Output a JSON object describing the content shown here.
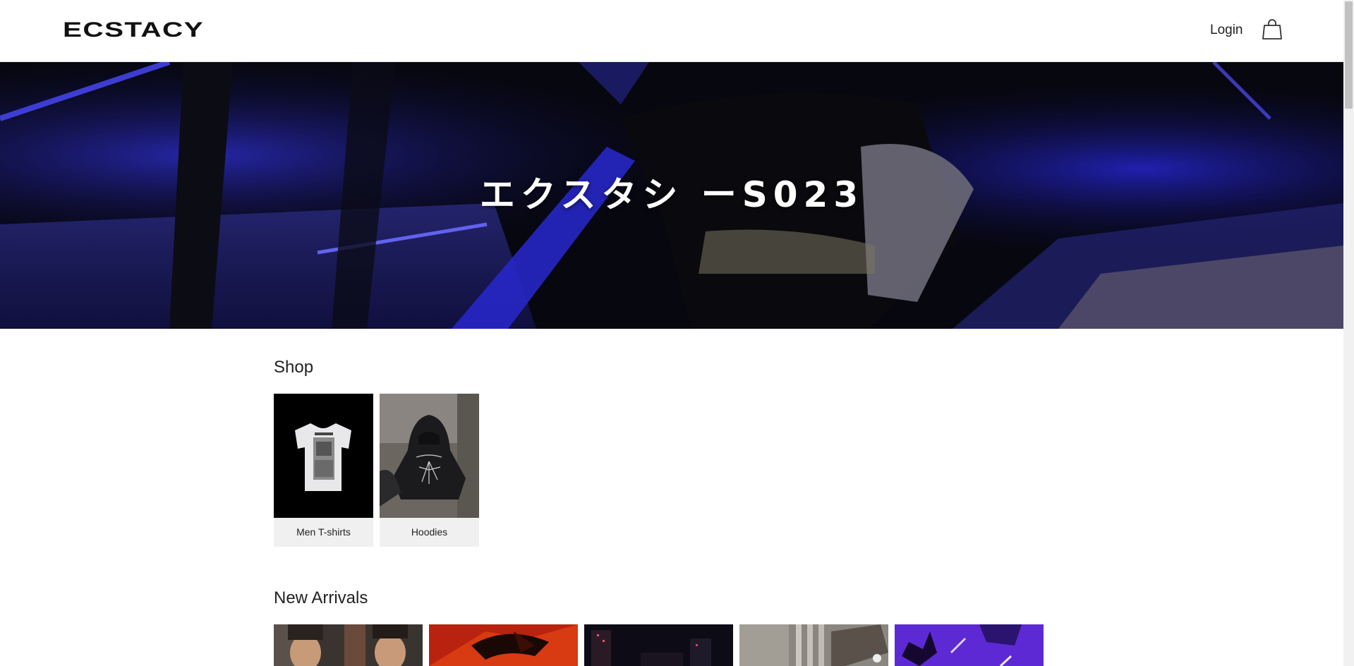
{
  "header": {
    "logo": "ECSTACY",
    "login_label": "Login",
    "cart_icon": "shopping-bag-icon"
  },
  "hero": {
    "title": "エクスタシ ーS023"
  },
  "shop": {
    "title": "Shop",
    "categories": [
      {
        "label": "Men T-shirts"
      },
      {
        "label": "Hoodies"
      }
    ]
  },
  "new_arrivals": {
    "title": "New Arrivals",
    "item_count_visible": 5
  },
  "colors": {
    "hero_blue": "#2a2ad8",
    "text": "#1f1f1f",
    "card_bg": "#f0f0f0"
  }
}
